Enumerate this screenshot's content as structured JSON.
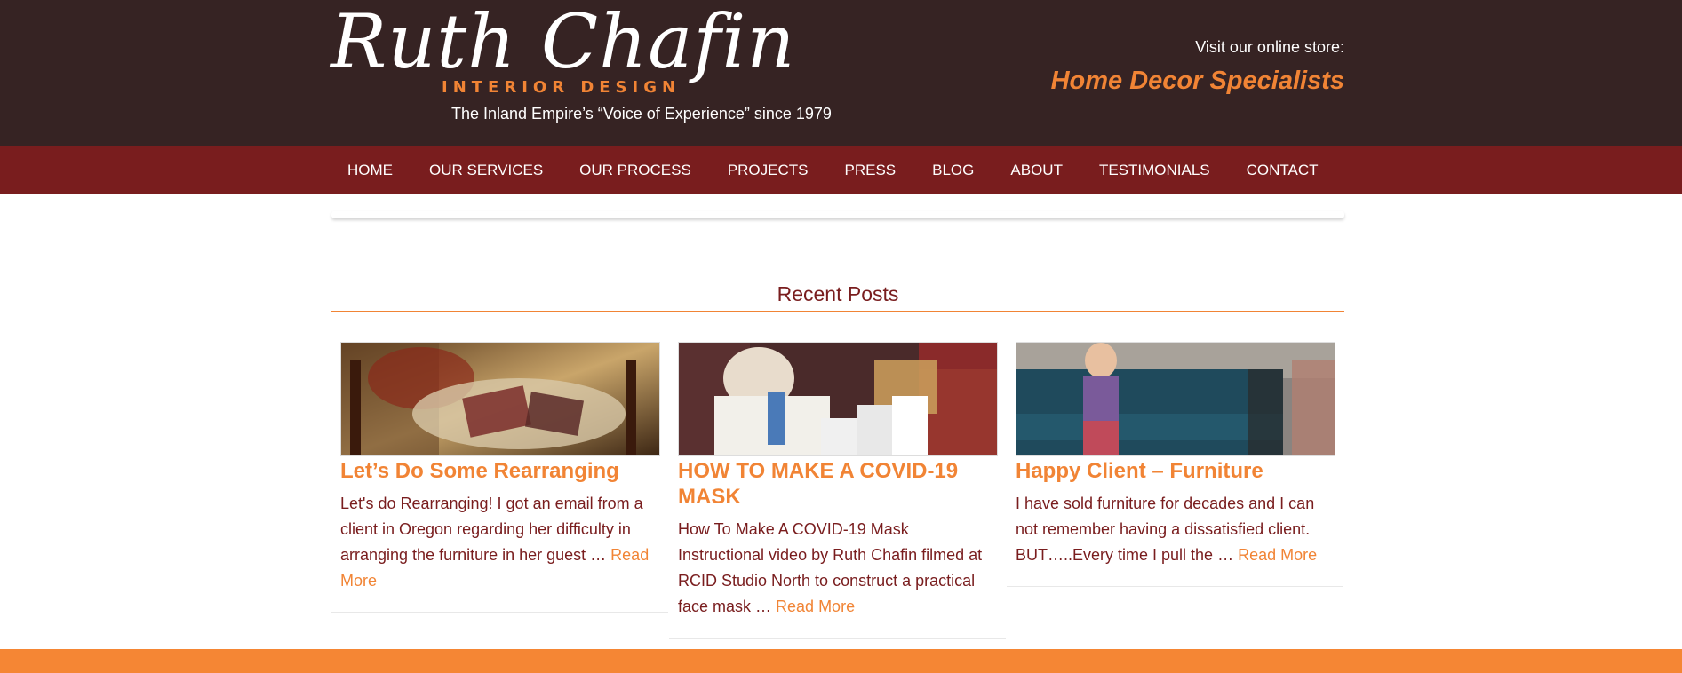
{
  "header": {
    "logo": {
      "name": "Ruth Chafin",
      "subtitle": "INTERIOR DESIGN",
      "tagline": "The Inland Empire’s “Voice of Experience” since 1979"
    },
    "store_label": "Visit our online store:",
    "store_link": "Home Decor Specialists"
  },
  "nav": {
    "items": [
      {
        "label": "HOME"
      },
      {
        "label": "OUR SERVICES"
      },
      {
        "label": "OUR PROCESS"
      },
      {
        "label": "PROJECTS"
      },
      {
        "label": "PRESS"
      },
      {
        "label": "BLOG"
      },
      {
        "label": "ABOUT"
      },
      {
        "label": "TESTIMONIALS"
      },
      {
        "label": "CONTACT"
      }
    ]
  },
  "recent": {
    "title": "Recent Posts",
    "posts": [
      {
        "title": "Let’s Do Some Rearranging",
        "excerpt": "Let's do Rearranging! I got an email from a client in Oregon regarding her difficulty in arranging the furniture in her guest … ",
        "read_more": "Read More"
      },
      {
        "title": "HOW TO MAKE A COVID-19 MASK",
        "excerpt": "How To Make A COVID-19 Mask Instructional video by Ruth Chafin filmed at RCID Studio North to construct a practical face mask … ",
        "read_more": "Read More"
      },
      {
        "title": "Happy Client – Furniture",
        "excerpt": "I have sold furniture for decades and I can not remember having a dissatisfied client. BUT…..Every time I pull the … ",
        "read_more": "Read More"
      }
    ]
  },
  "colors": {
    "header_bg": "#362323",
    "nav_bg": "#791d1e",
    "accent": "#f18435",
    "text": "#791d1e",
    "footer": "#f58634"
  }
}
